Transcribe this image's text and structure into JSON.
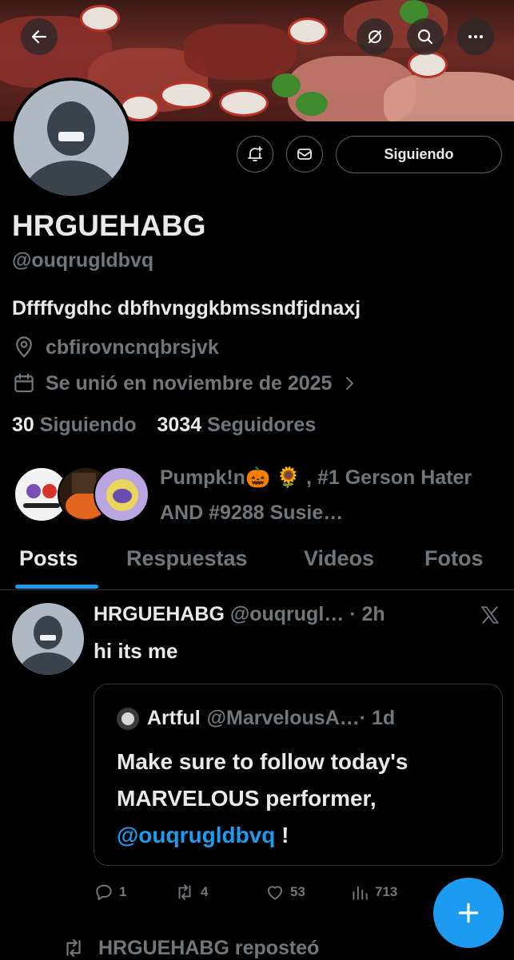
{
  "header": {
    "back_icon": "arrow-left-icon",
    "grok_icon": "slash-circle-icon",
    "search_icon": "search-icon",
    "more_icon": "more-horizontal-icon"
  },
  "profile": {
    "display_name": "HRGUEHABG",
    "handle": "@ouqrugldbvq",
    "bio": "Dffffvgdhc dbfhvnggkbmssndfjdnaxj",
    "location": "cbfirovncnqbrsjvk",
    "joined": "Se unió en noviembre de 2025",
    "following_count": "30",
    "following_label": "Siguiendo",
    "followers_count": "3034",
    "followers_label": "Seguidores",
    "follow_button_label": "Siguiendo",
    "followers_you_know": "Pumpk!n🎃 🌻 , #1 Gerson Hater AND #9288 Susie…"
  },
  "tabs": [
    {
      "label": "Posts",
      "active": true
    },
    {
      "label": "Respuestas",
      "active": false
    },
    {
      "label": "Videos",
      "active": false
    },
    {
      "label": "Fotos",
      "active": false
    }
  ],
  "post": {
    "author_name": "HRGUEHABG",
    "author_handle": "@ouqrugl…",
    "time": "· 2h",
    "text": "hi its me",
    "quote": {
      "author_name": "Artful",
      "author_handle": "@MarvelousA…",
      "time": "· 1d",
      "text_part1": "Make sure to follow today's MARVELOUS performer,",
      "mention": "@ouqrugldbvq",
      "text_part2": " !"
    },
    "replies": "1",
    "reposts": "4",
    "likes": "53",
    "views": "713"
  },
  "next_item": {
    "repost_label": "HRGUEHABG reposteó"
  },
  "colors": {
    "accent": "#1d9bf0",
    "secondary_text": "#71767b",
    "primary_text": "#e7e9ea",
    "background": "#000000"
  }
}
